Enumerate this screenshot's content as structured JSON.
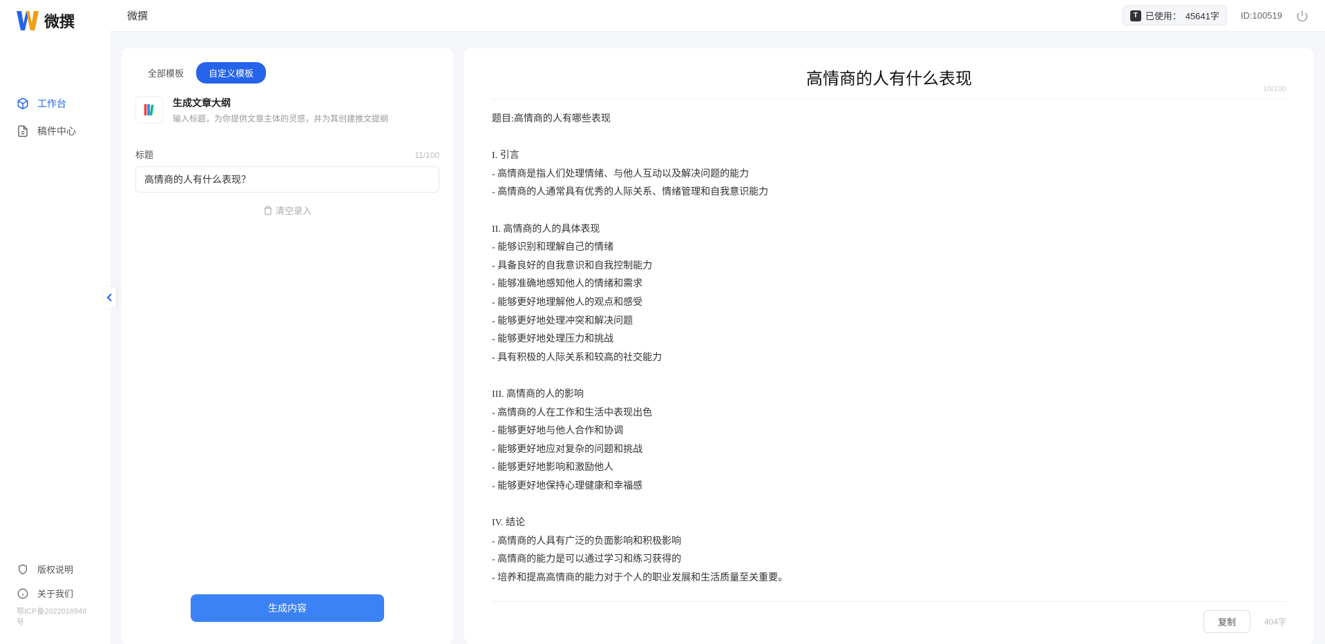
{
  "app": {
    "logo_text": "微撰",
    "title": "微撰"
  },
  "nav": {
    "items": [
      {
        "icon": "cube",
        "label": "工作台",
        "active": true
      },
      {
        "icon": "doc",
        "label": "稿件中心",
        "active": false
      }
    ],
    "footer": [
      {
        "icon": "shield",
        "label": "版权说明"
      },
      {
        "icon": "info",
        "label": "关于我们"
      }
    ],
    "icp": "鄂ICP备2022016946号"
  },
  "topbar": {
    "usage_prefix": "已使用：",
    "usage_value": "45641字",
    "user_id": "ID:100519"
  },
  "left": {
    "tabs": [
      {
        "label": "全部模板",
        "active": false
      },
      {
        "label": "自定义模板",
        "active": true
      }
    ],
    "template": {
      "title": "生成文章大纲",
      "desc": "输入标题，为你提供文章主体的灵感，并为其创建推文提纲"
    },
    "form": {
      "title_label": "标题",
      "title_count": "11/100",
      "title_value": "高情商的人有什么表现？",
      "clear_label": "清空录入"
    },
    "generate_btn": "生成内容"
  },
  "output": {
    "title": "高情商的人有什么表现",
    "title_count": "10/100",
    "body": "题目:高情商的人有哪些表现\n\nI. 引言\n- 高情商是指人们处理情绪、与他人互动以及解决问题的能力\n- 高情商的人通常具有优秀的人际关系、情绪管理和自我意识能力\n\nII. 高情商的人的具体表现\n- 能够识别和理解自己的情绪\n- 具备良好的自我意识和自我控制能力\n- 能够准确地感知他人的情绪和需求\n- 能够更好地理解他人的观点和感受\n- 能够更好地处理冲突和解决问题\n- 能够更好地处理压力和挑战\n- 具有积极的人际关系和较高的社交能力\n\nIII. 高情商的人的影响\n- 高情商的人在工作和生活中表现出色\n- 能够更好地与他人合作和协调\n- 能够更好地应对复杂的问题和挑战\n- 能够更好地影响和激励他人\n- 能够更好地保持心理健康和幸福感\n\nIV. 结论\n- 高情商的人具有广泛的负面影响和积极影响\n- 高情商的能力是可以通过学习和练习获得的\n- 培养和提高高情商的能力对于个人的职业发展和生活质量至关重要。",
    "copy_btn": "复制",
    "word_count": "404字"
  }
}
